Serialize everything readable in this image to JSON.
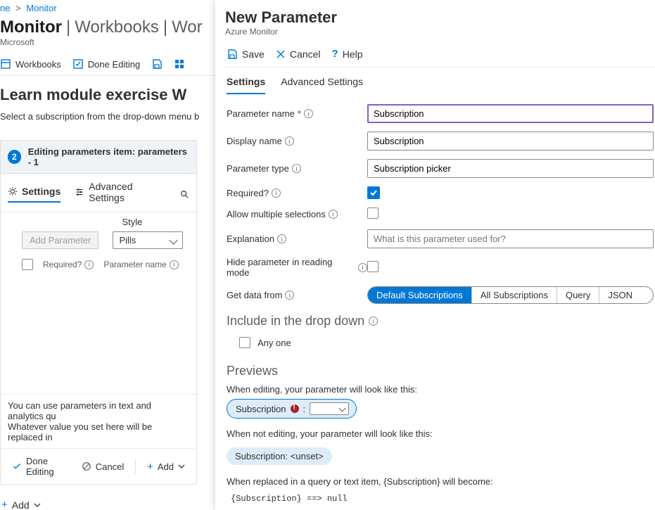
{
  "breadcrumb": {
    "item1": "ne",
    "item2": "Monitor"
  },
  "header": {
    "title_main": "Monitor",
    "title_sub1": "Workbooks",
    "title_sub2": "Wor",
    "tenant": "Microsoft"
  },
  "toolbar": {
    "workbooks": "Workbooks",
    "done_editing": "Done Editing"
  },
  "exercise": {
    "title": "Learn module exercise W",
    "description": "Select a subscription from the drop-down menu b"
  },
  "step": {
    "badge": "2",
    "header_text": "Editing parameters item: parameters - 1",
    "tabs": {
      "settings": "Settings",
      "advanced": "Advanced Settings"
    },
    "col_style_label": "Style",
    "add_parameter_btn": "Add Parameter",
    "style_value": "Pills",
    "th_required": "Required?",
    "th_param_name": "Parameter name",
    "hint_line1": "You can use parameters in text and analytics qu",
    "hint_line2": "Whatever value you set here will be replaced in",
    "actions": {
      "done": "Done Editing",
      "cancel": "Cancel",
      "add": "Add"
    }
  },
  "footer_add": "Add",
  "panel": {
    "title": "New Parameter",
    "subtitle": "Azure Monitor",
    "toolbar": {
      "save": "Save",
      "cancel": "Cancel",
      "help": "Help"
    },
    "tabs": {
      "settings": "Settings",
      "advanced": "Advanced Settings"
    },
    "form": {
      "param_name_label": "Parameter name",
      "param_name_value": "Subscription",
      "display_name_label": "Display name",
      "display_name_value": "Subscription",
      "param_type_label": "Parameter type",
      "param_type_value": "Subscription picker",
      "required_label": "Required?",
      "allow_multi_label": "Allow multiple selections",
      "explanation_label": "Explanation",
      "explanation_placeholder": "What is this parameter used for?",
      "hide_label": "Hide parameter in reading mode",
      "get_data_label": "Get data from",
      "pills": {
        "default_subs": "Default Subscriptions",
        "all_subs": "All Subscriptions",
        "query": "Query",
        "json": "JSON"
      }
    },
    "include_header": "Include in the drop down",
    "include_anyone": "Any one",
    "previews_header": "Previews",
    "preview_editing_text": "When editing, your parameter will look like this:",
    "preview_pill_label": "Subscription",
    "preview_not_editing_text": "When not editing, your parameter will look like this:",
    "preview_static_pill": "Subscription: <unset>",
    "preview_query_text": "When replaced in a query or text item, {Subscription} will become:",
    "preview_code": "{Subscription} ==> null"
  }
}
